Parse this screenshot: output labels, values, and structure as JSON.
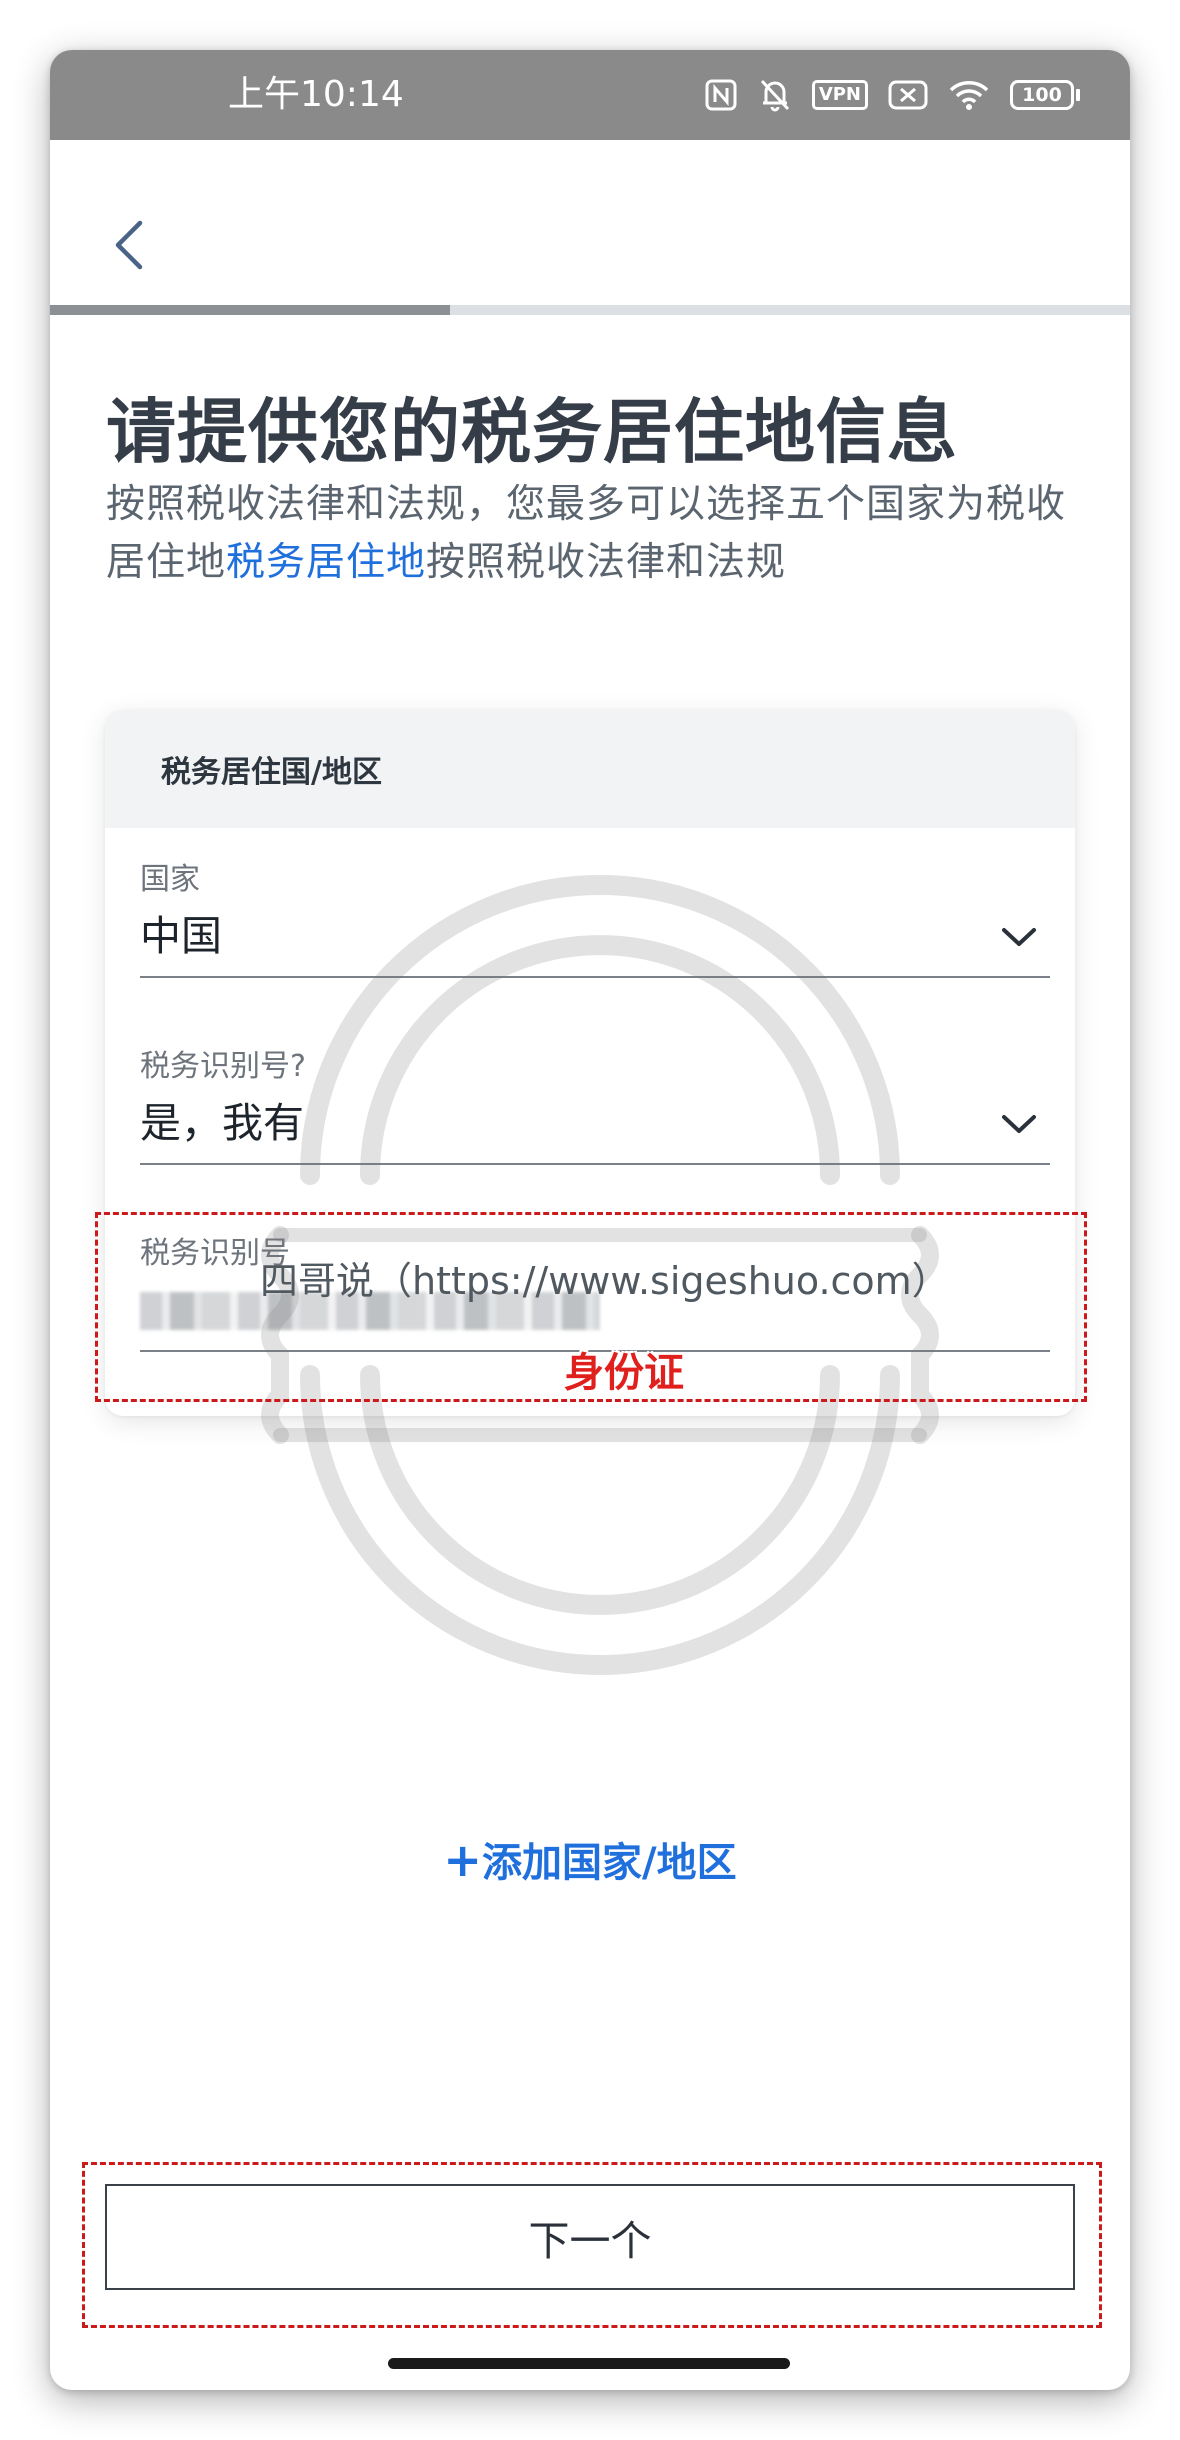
{
  "status_bar": {
    "time": "上午10:14",
    "battery": "100",
    "vpn_label": "VPN"
  },
  "header": {
    "progress_fraction": 0.37
  },
  "page": {
    "title": "请提供您的税务居住地信息",
    "subtitle_part1": "按照税收法律和法规，您最多可以选择五个国家为",
    "subtitle_part2": "税收居住地",
    "subtitle_link": "税务居住地",
    "subtitle_part3": "按照税收法律和法规"
  },
  "card": {
    "header": "税务居住国/地区",
    "country_label": "国家",
    "country_value": "中国",
    "tin_question_label": "税务识别号?",
    "tin_question_value": "是，我有",
    "tin_label": "税务识别号"
  },
  "watermark": {
    "text": "四哥说（https://www.sigeshuo.com）",
    "id_annotation": "身份证"
  },
  "actions": {
    "add_country": "添加国家/地区",
    "add_country_prefix": "+",
    "next": "下一个"
  },
  "colors": {
    "accent": "#1f6fdc",
    "annotation_red": "#cc1a1a",
    "status_bar": "#8a8a8a"
  }
}
